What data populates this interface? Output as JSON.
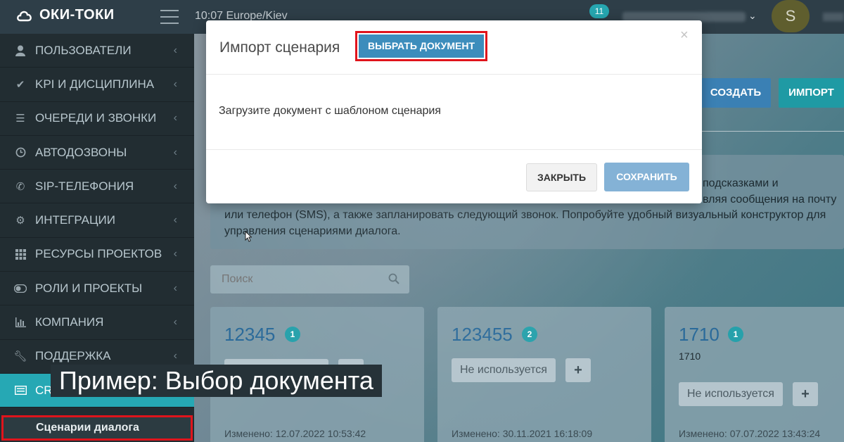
{
  "topbar": {
    "logo_text": "ОКИ-ТОКИ",
    "clock": "10:07 Europe/Kiev",
    "notifications_count": "11",
    "avatar_letter": "S"
  },
  "sidebar": {
    "items": [
      {
        "label": "ПОЛЬЗОВАТЕЛИ",
        "icon": "user-icon"
      },
      {
        "label": "KPI И ДИСЦИПЛИНА",
        "icon": "check-icon"
      },
      {
        "label": "ОЧЕРЕДИ И ЗВОНКИ",
        "icon": "list-icon"
      },
      {
        "label": "АВТОДОЗВОНЫ",
        "icon": "clock-icon"
      },
      {
        "label": "SIP-ТЕЛЕФОНИЯ",
        "icon": "phone-icon"
      },
      {
        "label": "ИНТЕГРАЦИИ",
        "icon": "gears-icon"
      },
      {
        "label": "РЕСУРСЫ ПРОЕКТОВ",
        "icon": "grid-icon"
      },
      {
        "label": "РОЛИ И ПРОЕКТЫ",
        "icon": "toggle-icon"
      },
      {
        "label": "КОМПАНИЯ",
        "icon": "bar-chart-icon"
      },
      {
        "label": "ПОДДЕРЖКА",
        "icon": "wrench-icon"
      },
      {
        "label": "CR",
        "icon": "card-icon"
      }
    ],
    "sub_item": "Сценарии диалога"
  },
  "toolbar": {
    "create_label": "СОЗДАТЬ",
    "import_label": "ИМПОРТ"
  },
  "info": {
    "line1_tail": "подсказками и",
    "line2_tail": "вляя сообщения на почту",
    "line3": "или телефон (SMS), а также запланировать следующий звонок. Попробуйте удобный визуальный конструктор для",
    "line4": "управления сценариями диалога."
  },
  "search": {
    "placeholder": "Поиск"
  },
  "cards": [
    {
      "title": "12345",
      "badge": "1",
      "subtitle": "",
      "status": "Не используется",
      "modified": "Изменено: 12.07.2022 10:53:42"
    },
    {
      "title": "123455",
      "badge": "2",
      "subtitle": "",
      "status": "Не используется",
      "modified": "Изменено: 30.11.2021 16:18:09"
    },
    {
      "title": "1710",
      "badge": "1",
      "subtitle": "1710",
      "status": "Не используется",
      "modified": "Изменено: 07.07.2022 13:43:24"
    }
  ],
  "modal": {
    "title": "Импорт сценария",
    "choose_label": "ВЫБРАТЬ ДОКУМЕНТ",
    "close_symbol": "×",
    "body": "Загрузите документ с шаблоном сценария",
    "close_label": "ЗАКРЫТЬ",
    "save_label": "СОХРАНИТЬ"
  },
  "caption": "Пример: Выбор документа",
  "colors": {
    "accent": "#26a8b4",
    "primary": "#3c8dbc",
    "highlight": "#e0141c"
  }
}
